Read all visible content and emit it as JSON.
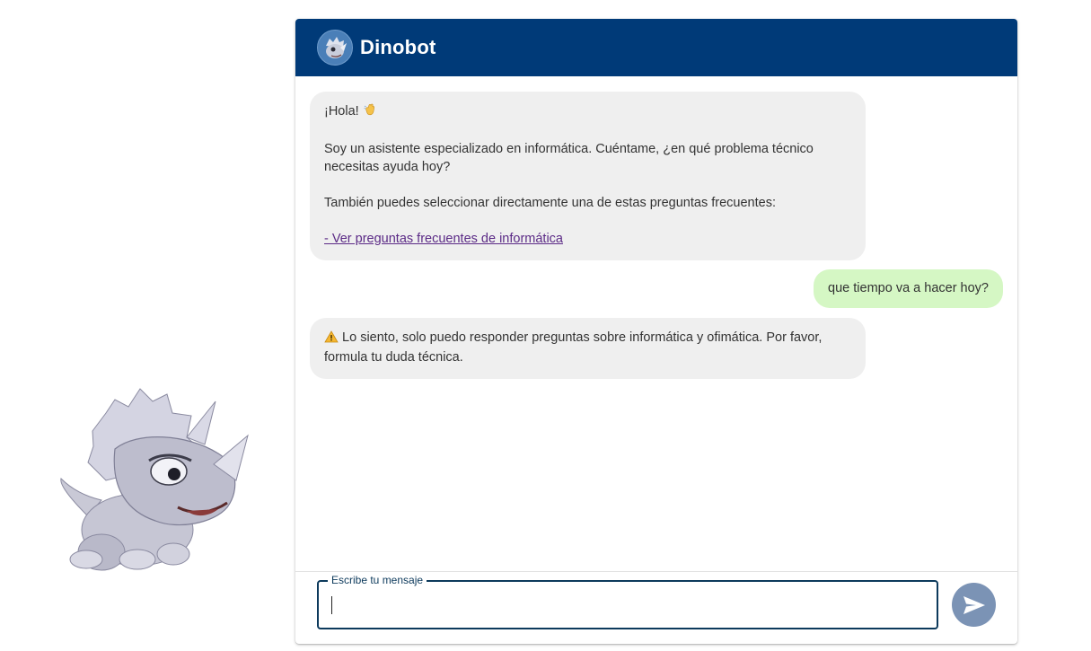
{
  "header": {
    "bot_name": "Dinobot",
    "color": "#003a78"
  },
  "messages": [
    {
      "from": "bot",
      "greeting": "¡Hola!",
      "greeting_emoji": "waving-hand",
      "intro": "Soy un asistente especializado en informática. Cuéntame, ¿en qué problema técnico necesitas ayuda hoy?",
      "faq_prompt": "También puedes seleccionar directamente una de estas preguntas frecuentes:",
      "faq_link": "- Ver preguntas frecuentes de informática"
    },
    {
      "from": "user",
      "text": "que tiempo va a hacer hoy?"
    },
    {
      "from": "bot",
      "icon": "warning-icon",
      "text": "Lo siento, solo puedo responder preguntas sobre informática y ofimática. Por favor, formula tu duda técnica."
    }
  ],
  "composer": {
    "label": "Escribe tu mensaje",
    "value": ""
  },
  "colors": {
    "bot_bubble": "#efefef",
    "user_bubble": "#d5f7c4",
    "link": "#5b2a86",
    "send_button": "#7b93b5"
  }
}
